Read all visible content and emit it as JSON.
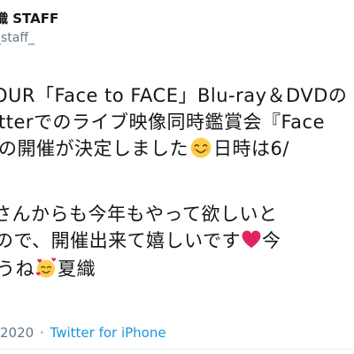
{
  "header": {
    "display_name": "織 STAFF",
    "handle": "_staff_"
  },
  "tweet": {
    "lines": [
      "OUR「Face to FACE」Blu-ray＆DVDの",
      "tterでのライブ映像同時鑑賞会『Face",
      "の開催が決定しました",
      "日時は6/",
      "さんからも今年もやって欲しいと",
      "ので、開催出来て嬉しいです",
      "今",
      "うね",
      "夏織"
    ],
    "emoji": [
      "smiling-face-emoji",
      "red-heart-emoji",
      "smiling-face-with-hearts-emoji"
    ]
  },
  "meta": {
    "date": "2020",
    "separator": "·",
    "source": "Twitter for iPhone"
  },
  "colors": {
    "text": "#14171a",
    "secondary": "#657786",
    "link": "#1b95e0",
    "heart": "#e0245e",
    "emoji_face": "#ffcc4d"
  }
}
